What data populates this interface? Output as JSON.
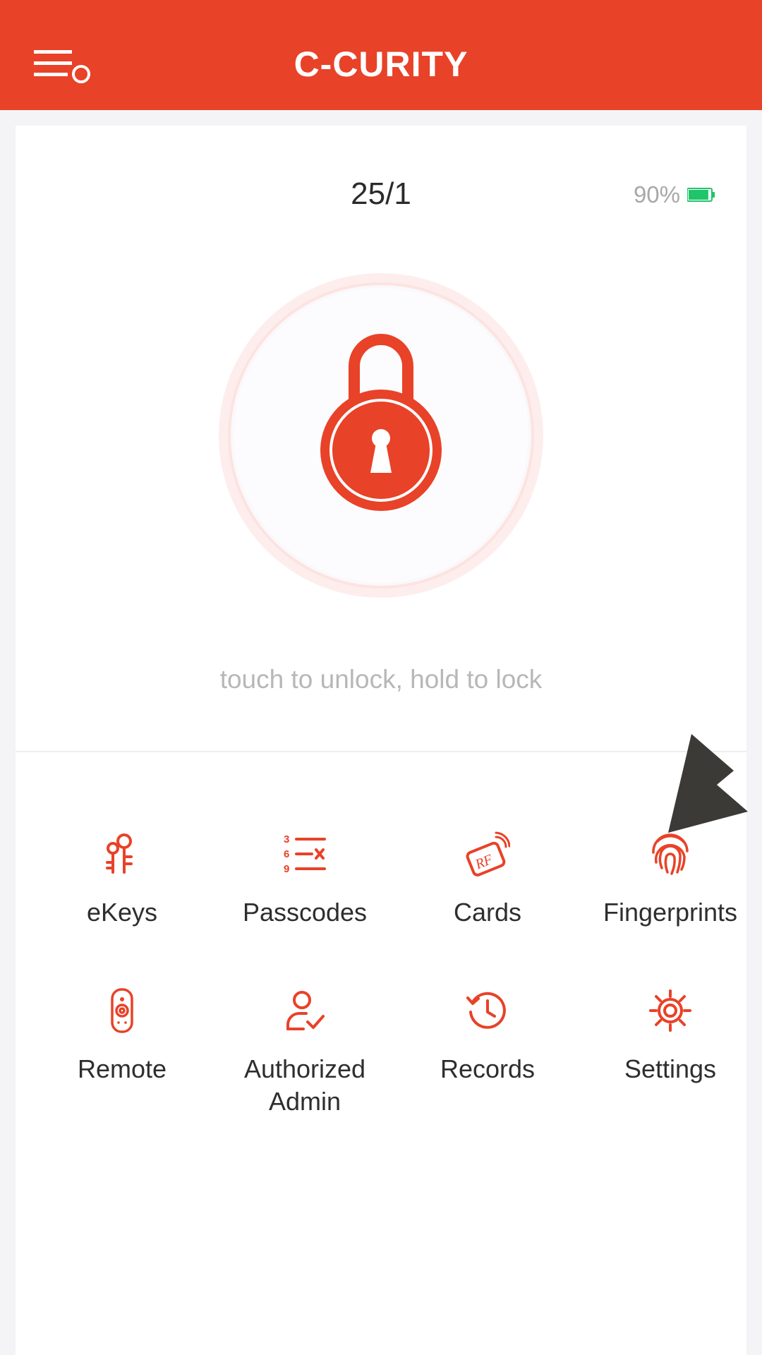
{
  "header": {
    "title": "C-CURITY",
    "menu_icon": "menu-icon"
  },
  "lock": {
    "name": "25/1",
    "battery_text": "90%",
    "battery_level": 0.9,
    "hint": "touch to unlock, hold to lock",
    "icon": "padlock-icon"
  },
  "menu": [
    {
      "label": "eKeys",
      "icon": "ekeys-icon"
    },
    {
      "label": "Passcodes",
      "icon": "passcodes-icon"
    },
    {
      "label": "Cards",
      "icon": "rf-card-icon"
    },
    {
      "label": "Fingerprints",
      "icon": "fingerprint-icon"
    },
    {
      "label": "Remote",
      "icon": "remote-icon"
    },
    {
      "label": "Authorized Admin",
      "icon": "authorized-admin-icon"
    },
    {
      "label": "Records",
      "icon": "records-icon"
    },
    {
      "label": "Settings",
      "icon": "settings-icon"
    }
  ],
  "colors": {
    "accent": "#e84228",
    "battery": "#1fc56b",
    "annotation_arrow": "#3c3a37"
  }
}
